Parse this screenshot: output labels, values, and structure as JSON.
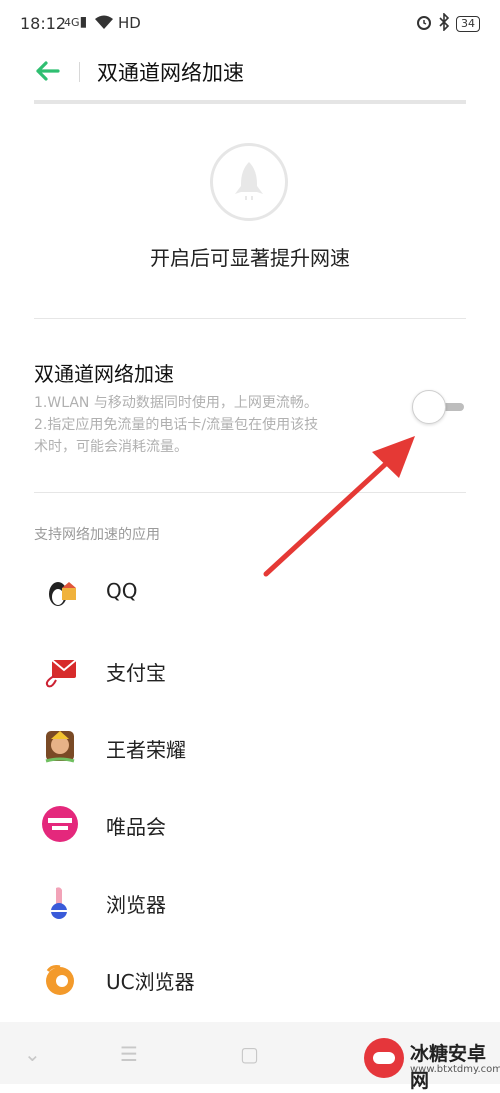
{
  "status_bar": {
    "time": "18:12",
    "signal": "4G",
    "network": "HD",
    "battery": "34"
  },
  "header": {
    "title": "双通道网络加速"
  },
  "hero": {
    "text": "开启后可显著提升网速"
  },
  "feature": {
    "title": "双通道网络加速",
    "desc_lines": [
      "1.WLAN 与移动数据同时使用，上网更流畅。",
      "2.指定应用免流量的电话卡/流量包在使用该技",
      "术时，可能会消耗流量。"
    ],
    "toggle_on": false
  },
  "apps": {
    "header": "支持网络加速的应用",
    "items": [
      {
        "name": "QQ",
        "icon": "qq-icon"
      },
      {
        "name": "支付宝",
        "icon": "alipay-icon"
      },
      {
        "name": "王者荣耀",
        "icon": "honor-of-kings-icon"
      },
      {
        "name": "唯品会",
        "icon": "vip-icon"
      },
      {
        "name": "浏览器",
        "icon": "browser-icon"
      },
      {
        "name": "UC浏览器",
        "icon": "uc-browser-icon"
      }
    ]
  },
  "watermark": {
    "name": "冰糖安卓网",
    "url": "www.btxtdmy.com"
  },
  "colors": {
    "accent": "#2fbf71",
    "annotation_arrow": "#e53935"
  }
}
